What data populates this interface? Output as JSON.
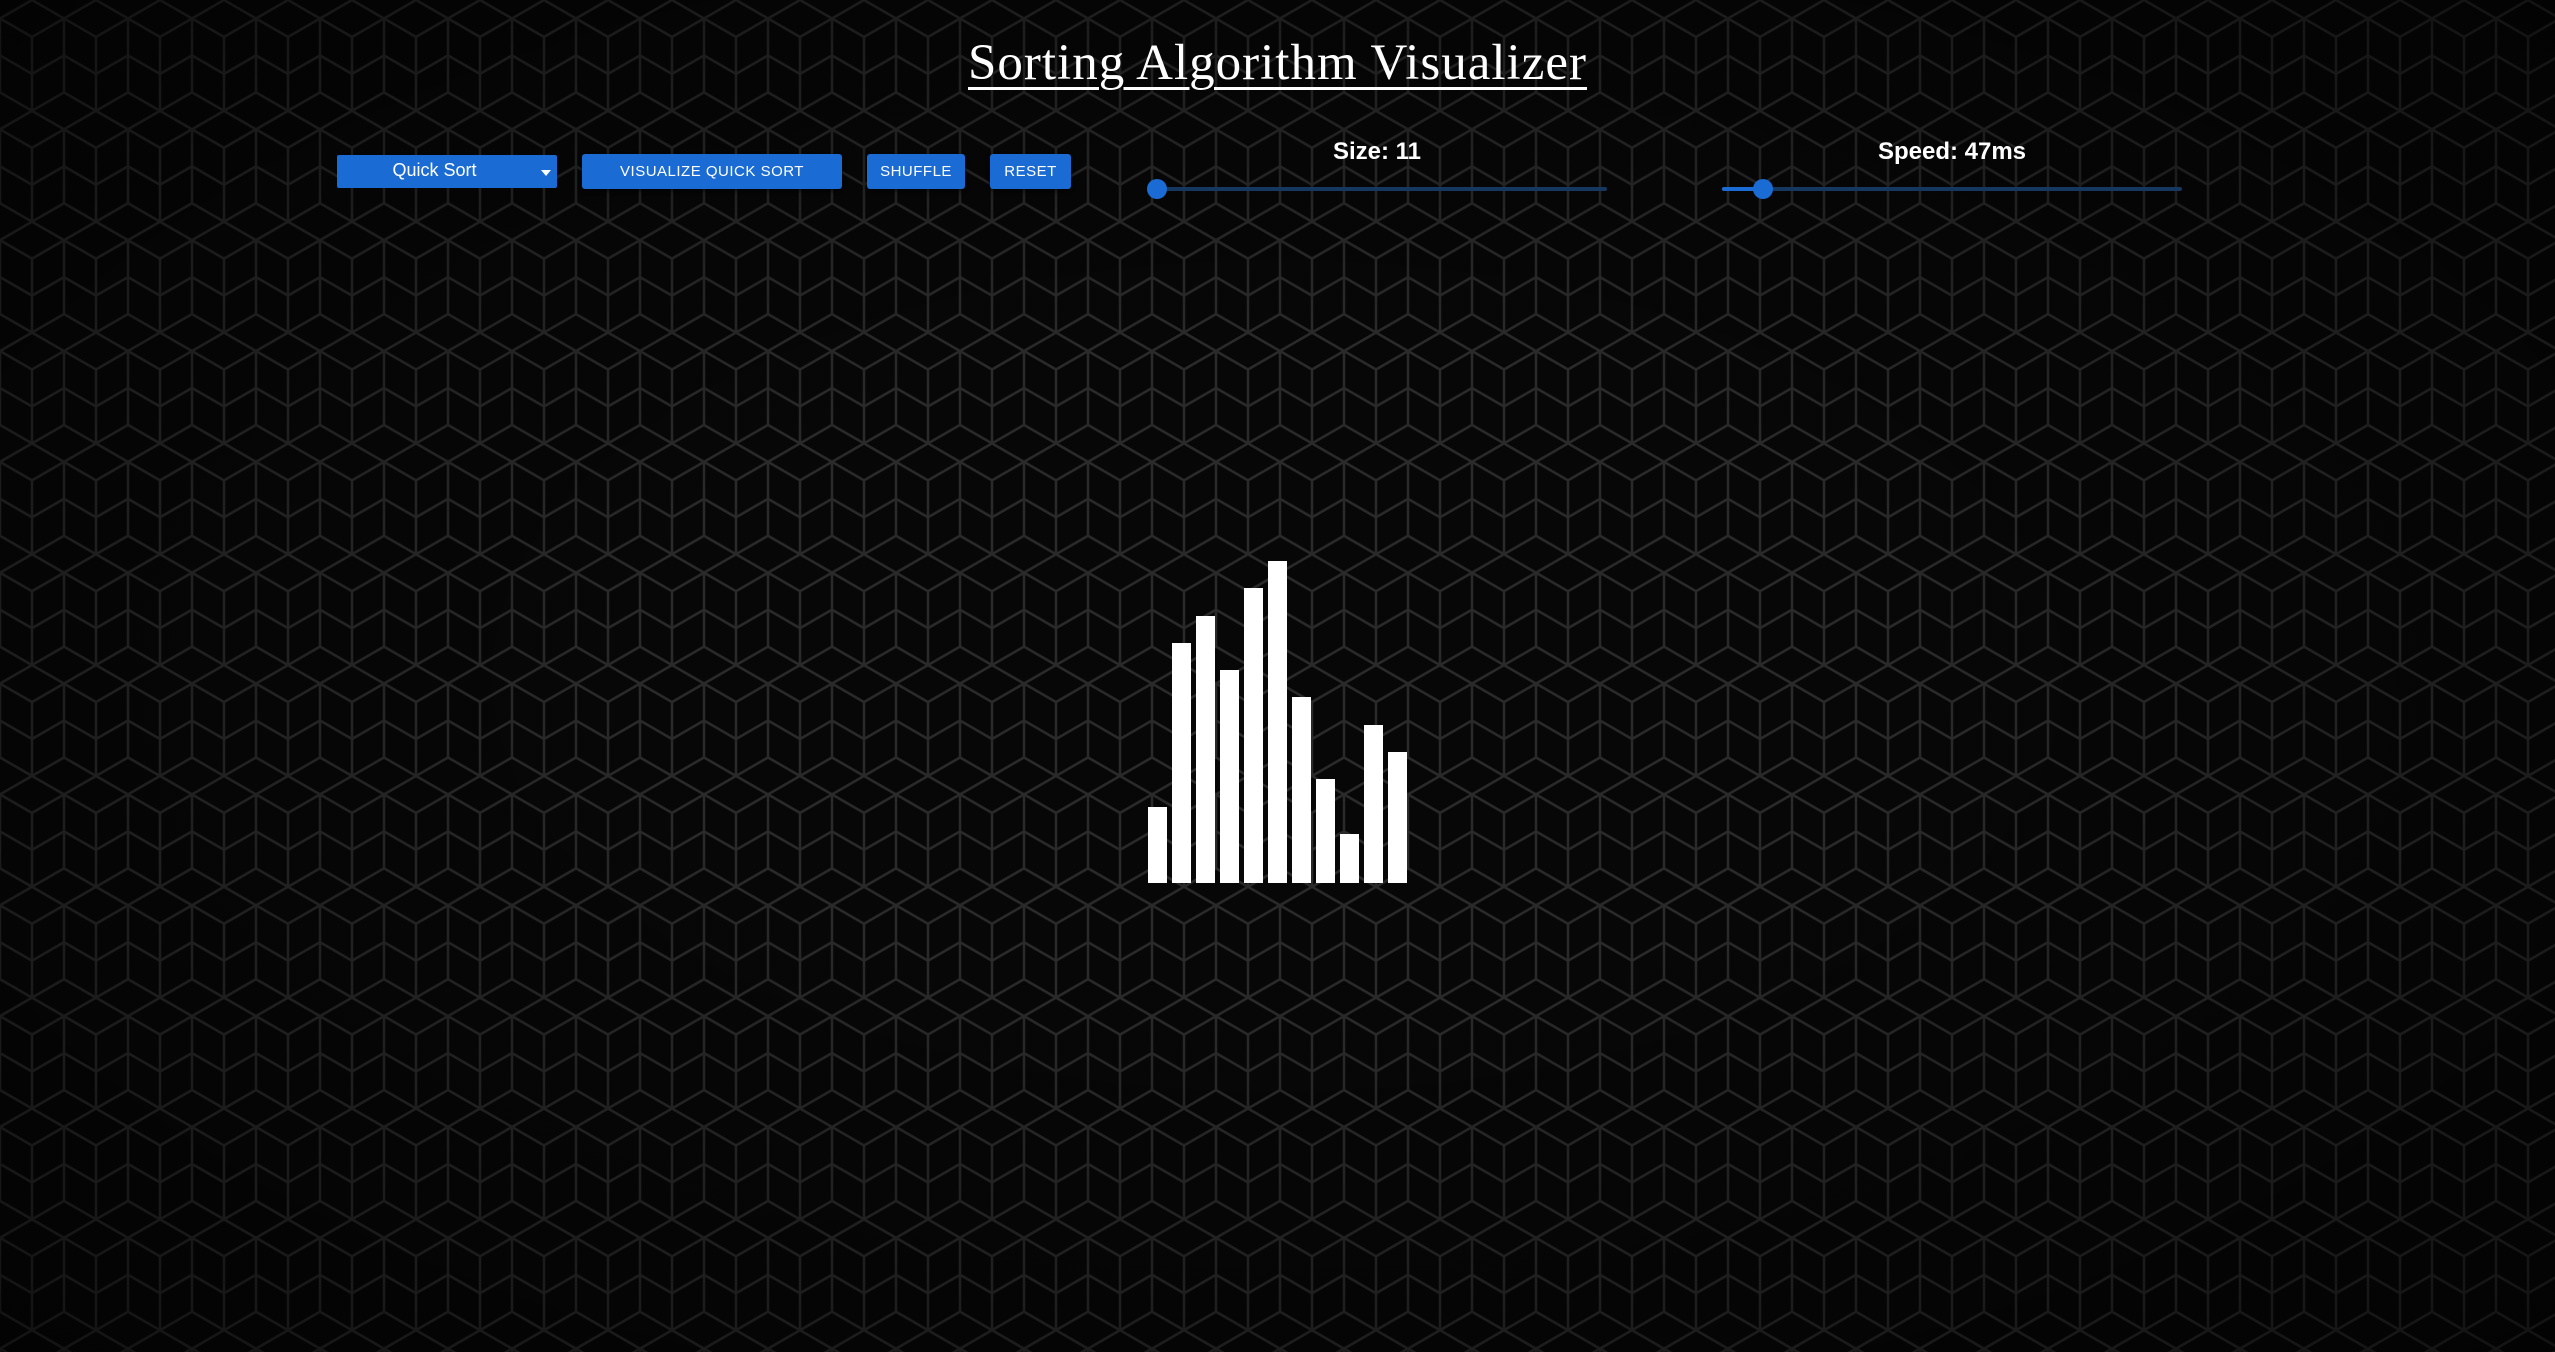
{
  "title": "Sorting Algorithm Visualizer",
  "controls": {
    "algorithm_select": {
      "selected": "Quick Sort"
    },
    "visualize_label": "VISUALIZE QUICK SORT",
    "shuffle_label": "SHUFFLE",
    "reset_label": "RESET",
    "size": {
      "label": "Size: 11",
      "value": 11,
      "min": 10,
      "max": 100,
      "fraction": 0.0
    },
    "speed": {
      "label": "Speed: 47ms",
      "value": 47,
      "fraction": 0.09
    }
  },
  "array": {
    "values": [
      28,
      88,
      98,
      78,
      108,
      118,
      68,
      38,
      18,
      58,
      48
    ],
    "max": 118
  },
  "colors": {
    "accent": "#1a6bd3",
    "bar": "#ffffff",
    "background": "#070707"
  }
}
